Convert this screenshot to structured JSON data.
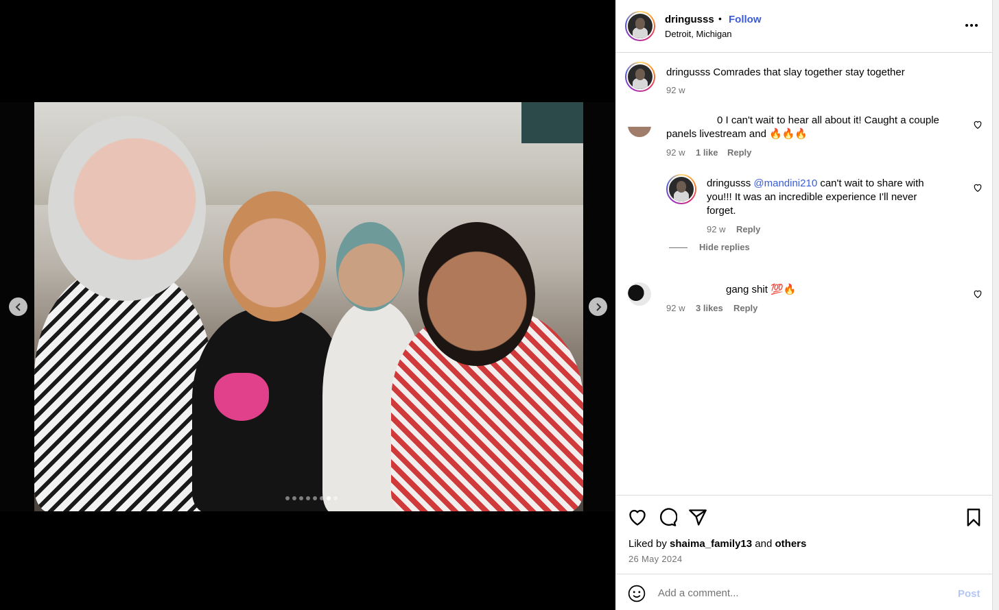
{
  "colors": {
    "accent": "#3b5bd6",
    "muted": "#737373",
    "divider": "#dbdbdb",
    "post_disabled": "#b2c6f7"
  },
  "carousel": {
    "slide_count": 8,
    "active_index": 6,
    "prev_icon": "chevron-left-icon",
    "next_icon": "chevron-right-icon"
  },
  "header": {
    "username": "dringusss",
    "separator": "•",
    "follow_label": "Follow",
    "location": "Detroit, Michigan",
    "more_icon": "more-horizontal-icon"
  },
  "caption": {
    "username": "dringusss",
    "text": "Comrades that slay together stay together",
    "time": "92 w"
  },
  "comments": [
    {
      "line1": "0 I can't wait to hear all about it! Caught a couple",
      "line2": "panels livestream and 🔥🔥🔥",
      "time": "92 w",
      "likes": "1 like",
      "reply_label": "Reply",
      "replies": [
        {
          "username": "dringusss",
          "mention": "@mandini210",
          "text1": "can't wait to share with",
          "text2": "you!!! It was an incredible experience I'll never",
          "text3": "forget.",
          "time": "92 w",
          "reply_label": "Reply"
        }
      ],
      "hide_replies_label": "Hide replies"
    },
    {
      "text": "gang shit 💯🔥",
      "time": "92 w",
      "likes": "3 likes",
      "reply_label": "Reply"
    }
  ],
  "actions": {
    "liked_prefix": "Liked by",
    "liked_user": "shaima_family13",
    "liked_and": "and",
    "liked_others": "others",
    "date": "26 May 2024"
  },
  "comment_box": {
    "placeholder": "Add a comment...",
    "post_label": "Post"
  }
}
